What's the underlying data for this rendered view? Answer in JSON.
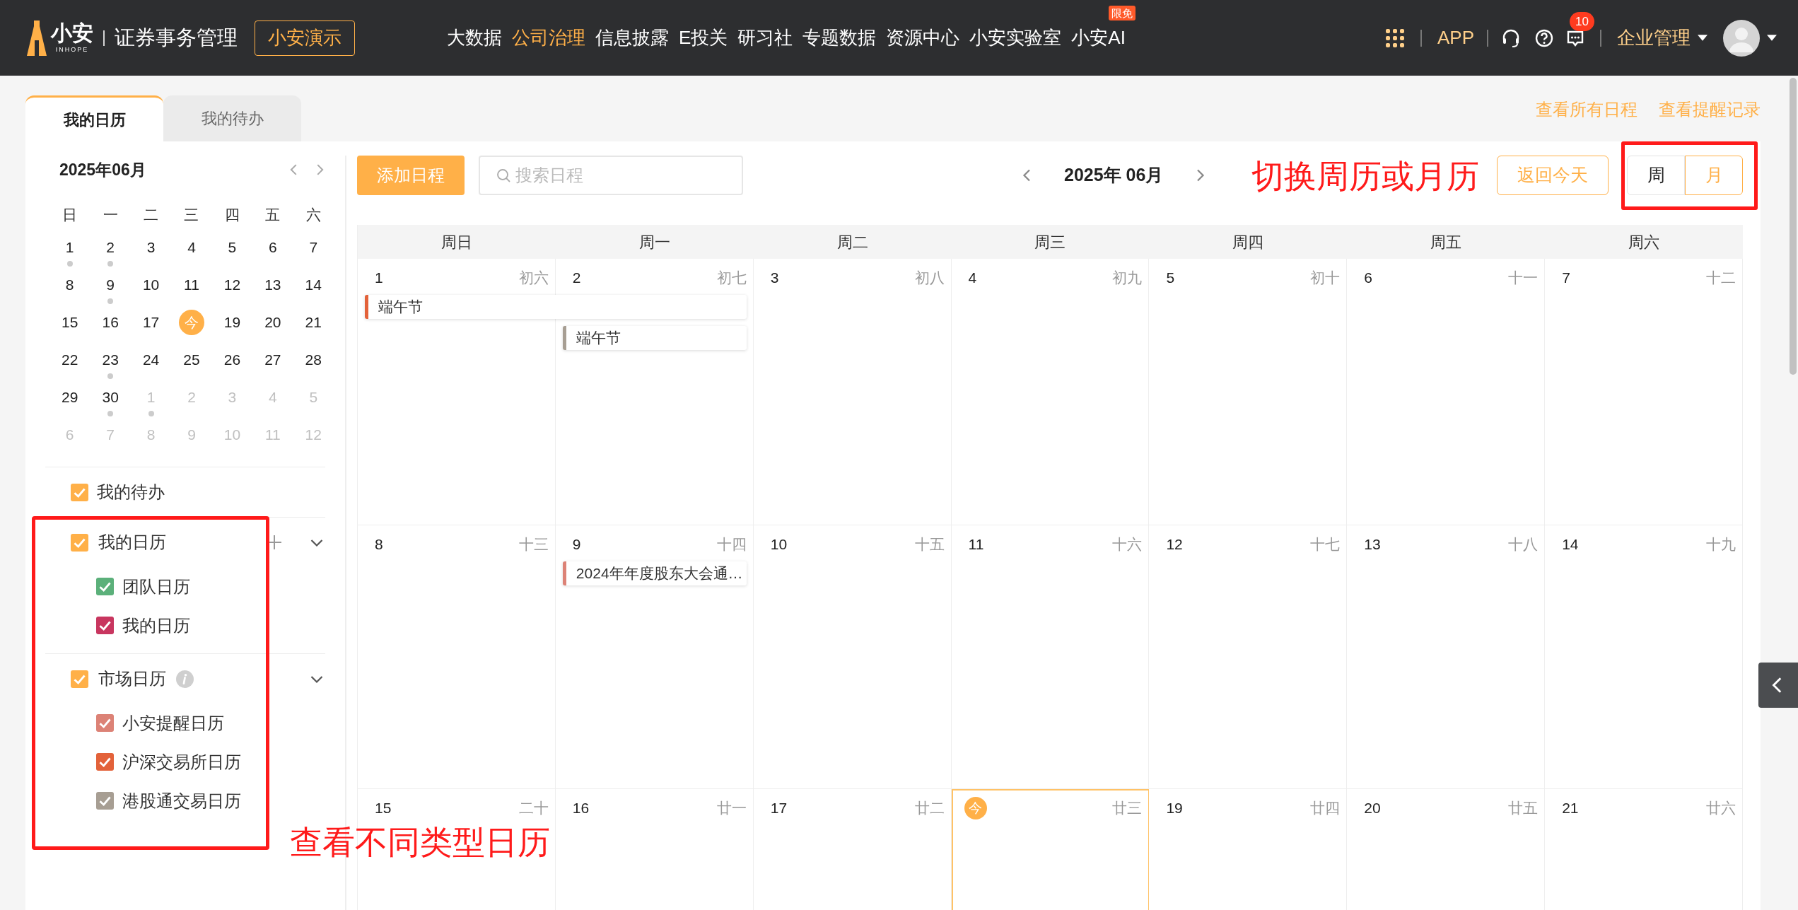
{
  "header": {
    "logo": {
      "brand": "小安",
      "sub": "INHOPE"
    },
    "product": "证券事务管理",
    "demo_button": "小安演示",
    "nav": [
      {
        "label": "大数据",
        "selected": false
      },
      {
        "label": "公司治理",
        "selected": true
      },
      {
        "label": "信息披露",
        "selected": false
      },
      {
        "label": "E投关",
        "selected": false
      },
      {
        "label": "研习社",
        "selected": false
      },
      {
        "label": "专题数据",
        "selected": false
      },
      {
        "label": "资源中心",
        "selected": false
      },
      {
        "label": "小安实验室",
        "selected": false
      },
      {
        "label": "小安AI",
        "selected": false,
        "badge": "限免"
      }
    ],
    "app": "APP",
    "notification_count": "10",
    "enterprise": "企业管理"
  },
  "top_links": [
    "查看所有日程",
    "查看提醒记录"
  ],
  "tabs": [
    {
      "label": "我的日历",
      "selected": true
    },
    {
      "label": "我的待办",
      "selected": false
    }
  ],
  "mini_calendar": {
    "title": "2025年06月",
    "weekdays": [
      "日",
      "一",
      "二",
      "三",
      "四",
      "五",
      "六"
    ],
    "days": [
      {
        "label": "1",
        "muted": false,
        "dot": true,
        "today": false
      },
      {
        "label": "2",
        "muted": false,
        "dot": true,
        "today": false
      },
      {
        "label": "3",
        "muted": false,
        "dot": false,
        "today": false
      },
      {
        "label": "4",
        "muted": false,
        "dot": false,
        "today": false
      },
      {
        "label": "5",
        "muted": false,
        "dot": false,
        "today": false
      },
      {
        "label": "6",
        "muted": false,
        "dot": false,
        "today": false
      },
      {
        "label": "7",
        "muted": false,
        "dot": false,
        "today": false
      },
      {
        "label": "8",
        "muted": false,
        "dot": false,
        "today": false
      },
      {
        "label": "9",
        "muted": false,
        "dot": true,
        "today": false
      },
      {
        "label": "10",
        "muted": false,
        "dot": false,
        "today": false
      },
      {
        "label": "11",
        "muted": false,
        "dot": false,
        "today": false
      },
      {
        "label": "12",
        "muted": false,
        "dot": false,
        "today": false
      },
      {
        "label": "13",
        "muted": false,
        "dot": false,
        "today": false
      },
      {
        "label": "14",
        "muted": false,
        "dot": false,
        "today": false
      },
      {
        "label": "15",
        "muted": false,
        "dot": false,
        "today": false
      },
      {
        "label": "16",
        "muted": false,
        "dot": false,
        "today": false
      },
      {
        "label": "17",
        "muted": false,
        "dot": false,
        "today": false
      },
      {
        "label": "今",
        "muted": false,
        "dot": false,
        "today": true
      },
      {
        "label": "19",
        "muted": false,
        "dot": false,
        "today": false
      },
      {
        "label": "20",
        "muted": false,
        "dot": false,
        "today": false
      },
      {
        "label": "21",
        "muted": false,
        "dot": false,
        "today": false
      },
      {
        "label": "22",
        "muted": false,
        "dot": false,
        "today": false
      },
      {
        "label": "23",
        "muted": false,
        "dot": true,
        "today": false
      },
      {
        "label": "24",
        "muted": false,
        "dot": false,
        "today": false
      },
      {
        "label": "25",
        "muted": false,
        "dot": false,
        "today": false
      },
      {
        "label": "26",
        "muted": false,
        "dot": false,
        "today": false
      },
      {
        "label": "27",
        "muted": false,
        "dot": false,
        "today": false
      },
      {
        "label": "28",
        "muted": false,
        "dot": false,
        "today": false
      },
      {
        "label": "29",
        "muted": false,
        "dot": false,
        "today": false
      },
      {
        "label": "30",
        "muted": false,
        "dot": true,
        "today": false
      },
      {
        "label": "1",
        "muted": true,
        "dot": true,
        "today": false
      },
      {
        "label": "2",
        "muted": true,
        "dot": false,
        "today": false
      },
      {
        "label": "3",
        "muted": true,
        "dot": false,
        "today": false
      },
      {
        "label": "4",
        "muted": true,
        "dot": false,
        "today": false
      },
      {
        "label": "5",
        "muted": true,
        "dot": false,
        "today": false
      },
      {
        "label": "6",
        "muted": true,
        "dot": false,
        "today": false
      },
      {
        "label": "7",
        "muted": true,
        "dot": false,
        "today": false
      },
      {
        "label": "8",
        "muted": true,
        "dot": false,
        "today": false
      },
      {
        "label": "9",
        "muted": true,
        "dot": false,
        "today": false
      },
      {
        "label": "10",
        "muted": true,
        "dot": false,
        "today": false
      },
      {
        "label": "11",
        "muted": true,
        "dot": false,
        "today": false
      },
      {
        "label": "12",
        "muted": true,
        "dot": false,
        "today": false
      }
    ]
  },
  "todo_filter": {
    "label": "我的待办",
    "checked": true
  },
  "calendar_groups": [
    {
      "label": "我的日历",
      "checked": true,
      "add": true,
      "expanded": true,
      "children": [
        {
          "label": "团队日历",
          "checked": true,
          "color": "#5bb07a"
        },
        {
          "label": "我的日历",
          "checked": true,
          "color": "#c8365f"
        }
      ]
    },
    {
      "label": "市场日历",
      "checked": true,
      "info": true,
      "expanded": true,
      "children": [
        {
          "label": "小安提醒日历",
          "checked": true,
          "color": "#dc8276"
        },
        {
          "label": "沪深交易所日历",
          "checked": true,
          "color": "#e3623a"
        },
        {
          "label": "港股通交易日历",
          "checked": true,
          "color": "#a79e93"
        }
      ]
    }
  ],
  "toolbar": {
    "add_button": "添加日程",
    "search": {
      "placeholder": "搜索日程"
    },
    "month_label": "2025年 06月",
    "today_button": "返回今天",
    "view_toggle": [
      {
        "label": "周",
        "selected": false
      },
      {
        "label": "月",
        "selected": true
      }
    ]
  },
  "week_headers": [
    "周日",
    "周一",
    "周二",
    "周三",
    "周四",
    "周五",
    "周六"
  ],
  "weeks": [
    {
      "days": [
        {
          "date": "1",
          "lunar": "初六",
          "today": false,
          "events": [
            {
              "title": "端午节",
              "color": "#e3623a",
              "continues": true
            }
          ]
        },
        {
          "date": "2",
          "lunar": "初七",
          "today": false,
          "events": [
            {
              "title": "端午节",
              "color": "#a79e93",
              "continues": false
            }
          ]
        },
        {
          "date": "3",
          "lunar": "初八",
          "today": false
        },
        {
          "date": "4",
          "lunar": "初九",
          "today": false
        },
        {
          "date": "5",
          "lunar": "初十",
          "today": false
        },
        {
          "date": "6",
          "lunar": "十一",
          "today": false
        },
        {
          "date": "7",
          "lunar": "十二",
          "today": false
        }
      ]
    },
    {
      "days": [
        {
          "date": "8",
          "lunar": "十三",
          "today": false
        },
        {
          "date": "9",
          "lunar": "十四",
          "today": false,
          "events": [
            {
              "title": "2024年年度股东大会通…",
              "color": "#dc8276",
              "continues": false
            }
          ]
        },
        {
          "date": "10",
          "lunar": "十五",
          "today": false
        },
        {
          "date": "11",
          "lunar": "十六",
          "today": false
        },
        {
          "date": "12",
          "lunar": "十七",
          "today": false
        },
        {
          "date": "13",
          "lunar": "十八",
          "today": false
        },
        {
          "date": "14",
          "lunar": "十九",
          "today": false
        }
      ]
    },
    {
      "days": [
        {
          "date": "15",
          "lunar": "二十",
          "today": false
        },
        {
          "date": "16",
          "lunar": "廿一",
          "today": false
        },
        {
          "date": "17",
          "lunar": "廿二",
          "today": false
        },
        {
          "date": "今",
          "lunar": "廿三",
          "today": true
        },
        {
          "date": "19",
          "lunar": "廿四",
          "today": false
        },
        {
          "date": "20",
          "lunar": "廿五",
          "today": false
        },
        {
          "date": "21",
          "lunar": "廿六",
          "today": false
        }
      ]
    }
  ],
  "annotations": {
    "view_switch": "切换周历或月历",
    "calendar_types": "查看不同类型日历"
  }
}
